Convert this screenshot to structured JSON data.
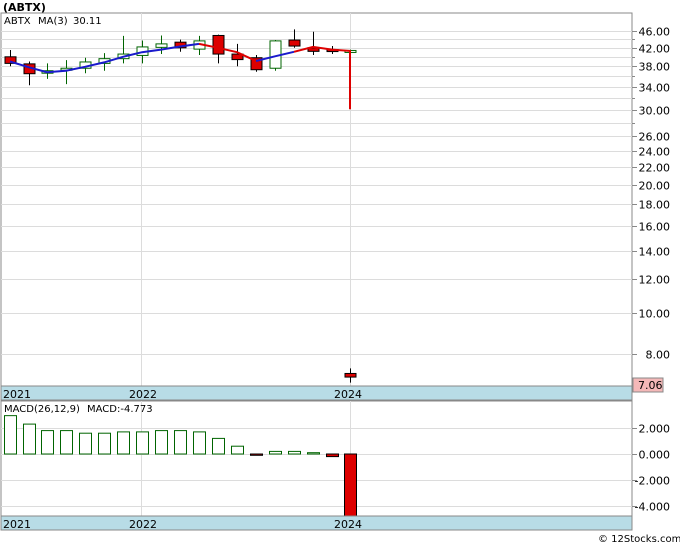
{
  "title": "(ABTX)",
  "price_panel": {
    "ticker_label": "ABTX",
    "ma_label": "MA(3)",
    "ma_value": "30.11",
    "last_price_tag": "7.06",
    "y_ticks": [
      "46.00",
      "42.00",
      "38.00",
      "34.00",
      "30.00",
      "26.00",
      "24.00",
      "22.00",
      "20.00",
      "18.00",
      "16.00",
      "14.00",
      "12.00",
      "10.00",
      "8.00"
    ],
    "x_labels": [
      "2021",
      "2022",
      "2024"
    ]
  },
  "macd_panel": {
    "label": "MACD(26,12,9)",
    "value_label": "MACD:-4.773",
    "y_ticks": [
      "2.000",
      "0.000",
      "-2.000",
      "-4.000"
    ],
    "x_labels": [
      "2021",
      "2022",
      "2024"
    ]
  },
  "watermark": "© 12Stocks.com",
  "colors": {
    "up": "#006400",
    "down": "#dd0000",
    "ma": "#1a1acc",
    "ma_down": "#dd0000",
    "axis_band": "#b8dce6"
  },
  "chart_data": [
    {
      "type": "candlestick",
      "scale": "log",
      "ylim": [
        7,
        48
      ],
      "candles": [
        {
          "o": 40.0,
          "h": 41.5,
          "l": 38.0,
          "c": 38.6
        },
        {
          "o": 38.5,
          "h": 39.0,
          "l": 34.3,
          "c": 36.5
        },
        {
          "o": 36.6,
          "h": 38.6,
          "l": 35.5,
          "c": 37.1
        },
        {
          "o": 37.2,
          "h": 39.3,
          "l": 34.5,
          "c": 37.6
        },
        {
          "o": 37.6,
          "h": 39.8,
          "l": 36.6,
          "c": 38.9
        },
        {
          "o": 38.6,
          "h": 40.8,
          "l": 37.1,
          "c": 39.6
        },
        {
          "o": 39.6,
          "h": 44.8,
          "l": 38.6,
          "c": 40.6
        },
        {
          "o": 40.3,
          "h": 43.7,
          "l": 38.6,
          "c": 42.2
        },
        {
          "o": 42.1,
          "h": 44.9,
          "l": 40.6,
          "c": 42.9
        },
        {
          "o": 43.3,
          "h": 43.9,
          "l": 41.1,
          "c": 42.0
        },
        {
          "o": 41.7,
          "h": 44.8,
          "l": 40.4,
          "c": 43.6
        },
        {
          "o": 44.9,
          "h": 45.1,
          "l": 38.6,
          "c": 40.6
        },
        {
          "o": 40.6,
          "h": 42.9,
          "l": 38.0,
          "c": 39.4
        },
        {
          "o": 39.8,
          "h": 40.4,
          "l": 36.9,
          "c": 37.3
        },
        {
          "o": 37.6,
          "h": 43.8,
          "l": 37.1,
          "c": 43.6
        },
        {
          "o": 43.8,
          "h": 46.4,
          "l": 42.0,
          "c": 42.4
        },
        {
          "o": 42.0,
          "h": 45.8,
          "l": 40.4,
          "c": 41.2
        },
        {
          "o": 41.6,
          "h": 42.4,
          "l": 40.6,
          "c": 41.3
        },
        {
          "o": 41.2,
          "h": 41.6,
          "l": 40.9,
          "c": 41.4
        },
        {
          "o": 7.2,
          "h": 7.4,
          "l": 6.85,
          "c": 7.06
        }
      ],
      "ma": [
        39.0,
        37.8,
        36.8,
        37.1,
        37.9,
        38.8,
        40.0,
        41.0,
        41.6,
        42.3,
        42.9,
        42.0,
        41.0,
        39.1,
        40.1,
        41.1,
        42.2,
        41.6,
        41.3,
        30.1
      ]
    },
    {
      "type": "bar",
      "series_name": "MACD(26,12,9)",
      "ylim": [
        -4.8,
        3.2
      ],
      "values": [
        2.95,
        2.3,
        1.8,
        1.8,
        1.6,
        1.6,
        1.7,
        1.7,
        1.8,
        1.8,
        1.7,
        1.2,
        0.6,
        -0.1,
        0.2,
        0.2,
        0.1,
        -0.2,
        -0.25,
        -4.773
      ]
    }
  ]
}
